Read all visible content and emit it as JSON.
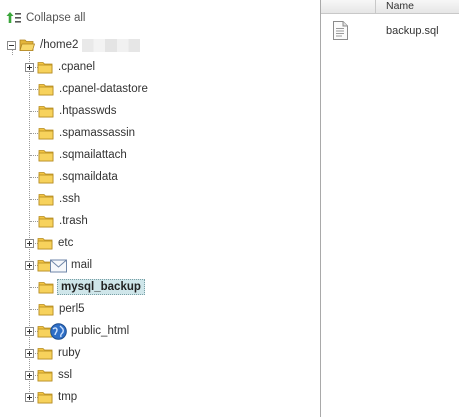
{
  "toolbar": {
    "collapse_all_label": "Collapse all"
  },
  "tree": {
    "root": {
      "label": "/home2"
    },
    "items": [
      {
        "label": ".cpanel",
        "expander": "plus"
      },
      {
        "label": ".cpanel-datastore",
        "expander": "none"
      },
      {
        "label": ".htpasswds",
        "expander": "none"
      },
      {
        "label": ".spamassassin",
        "expander": "none"
      },
      {
        "label": ".sqmailattach",
        "expander": "none"
      },
      {
        "label": ".sqmaildata",
        "expander": "none"
      },
      {
        "label": ".ssh",
        "expander": "none"
      },
      {
        "label": ".trash",
        "expander": "none"
      },
      {
        "label": "etc",
        "expander": "plus"
      },
      {
        "label": "mail",
        "expander": "plus",
        "overlay": "envelope-icon"
      },
      {
        "label": "mysql_backup",
        "expander": "none",
        "selected": true
      },
      {
        "label": "perl5",
        "expander": "none"
      },
      {
        "label": "public_html",
        "expander": "plus",
        "overlay": "globe-icon"
      },
      {
        "label": "ruby",
        "expander": "plus"
      },
      {
        "label": "ssl",
        "expander": "plus"
      },
      {
        "label": "tmp",
        "expander": "plus"
      }
    ]
  },
  "file_list": {
    "columns": [
      "Name"
    ],
    "rows": [
      {
        "name": "backup.sql",
        "icon": "document-icon"
      }
    ]
  },
  "colors": {
    "folder": "#f4c542",
    "selection": "#cfe6ea",
    "divider": "#a9a9a9"
  }
}
